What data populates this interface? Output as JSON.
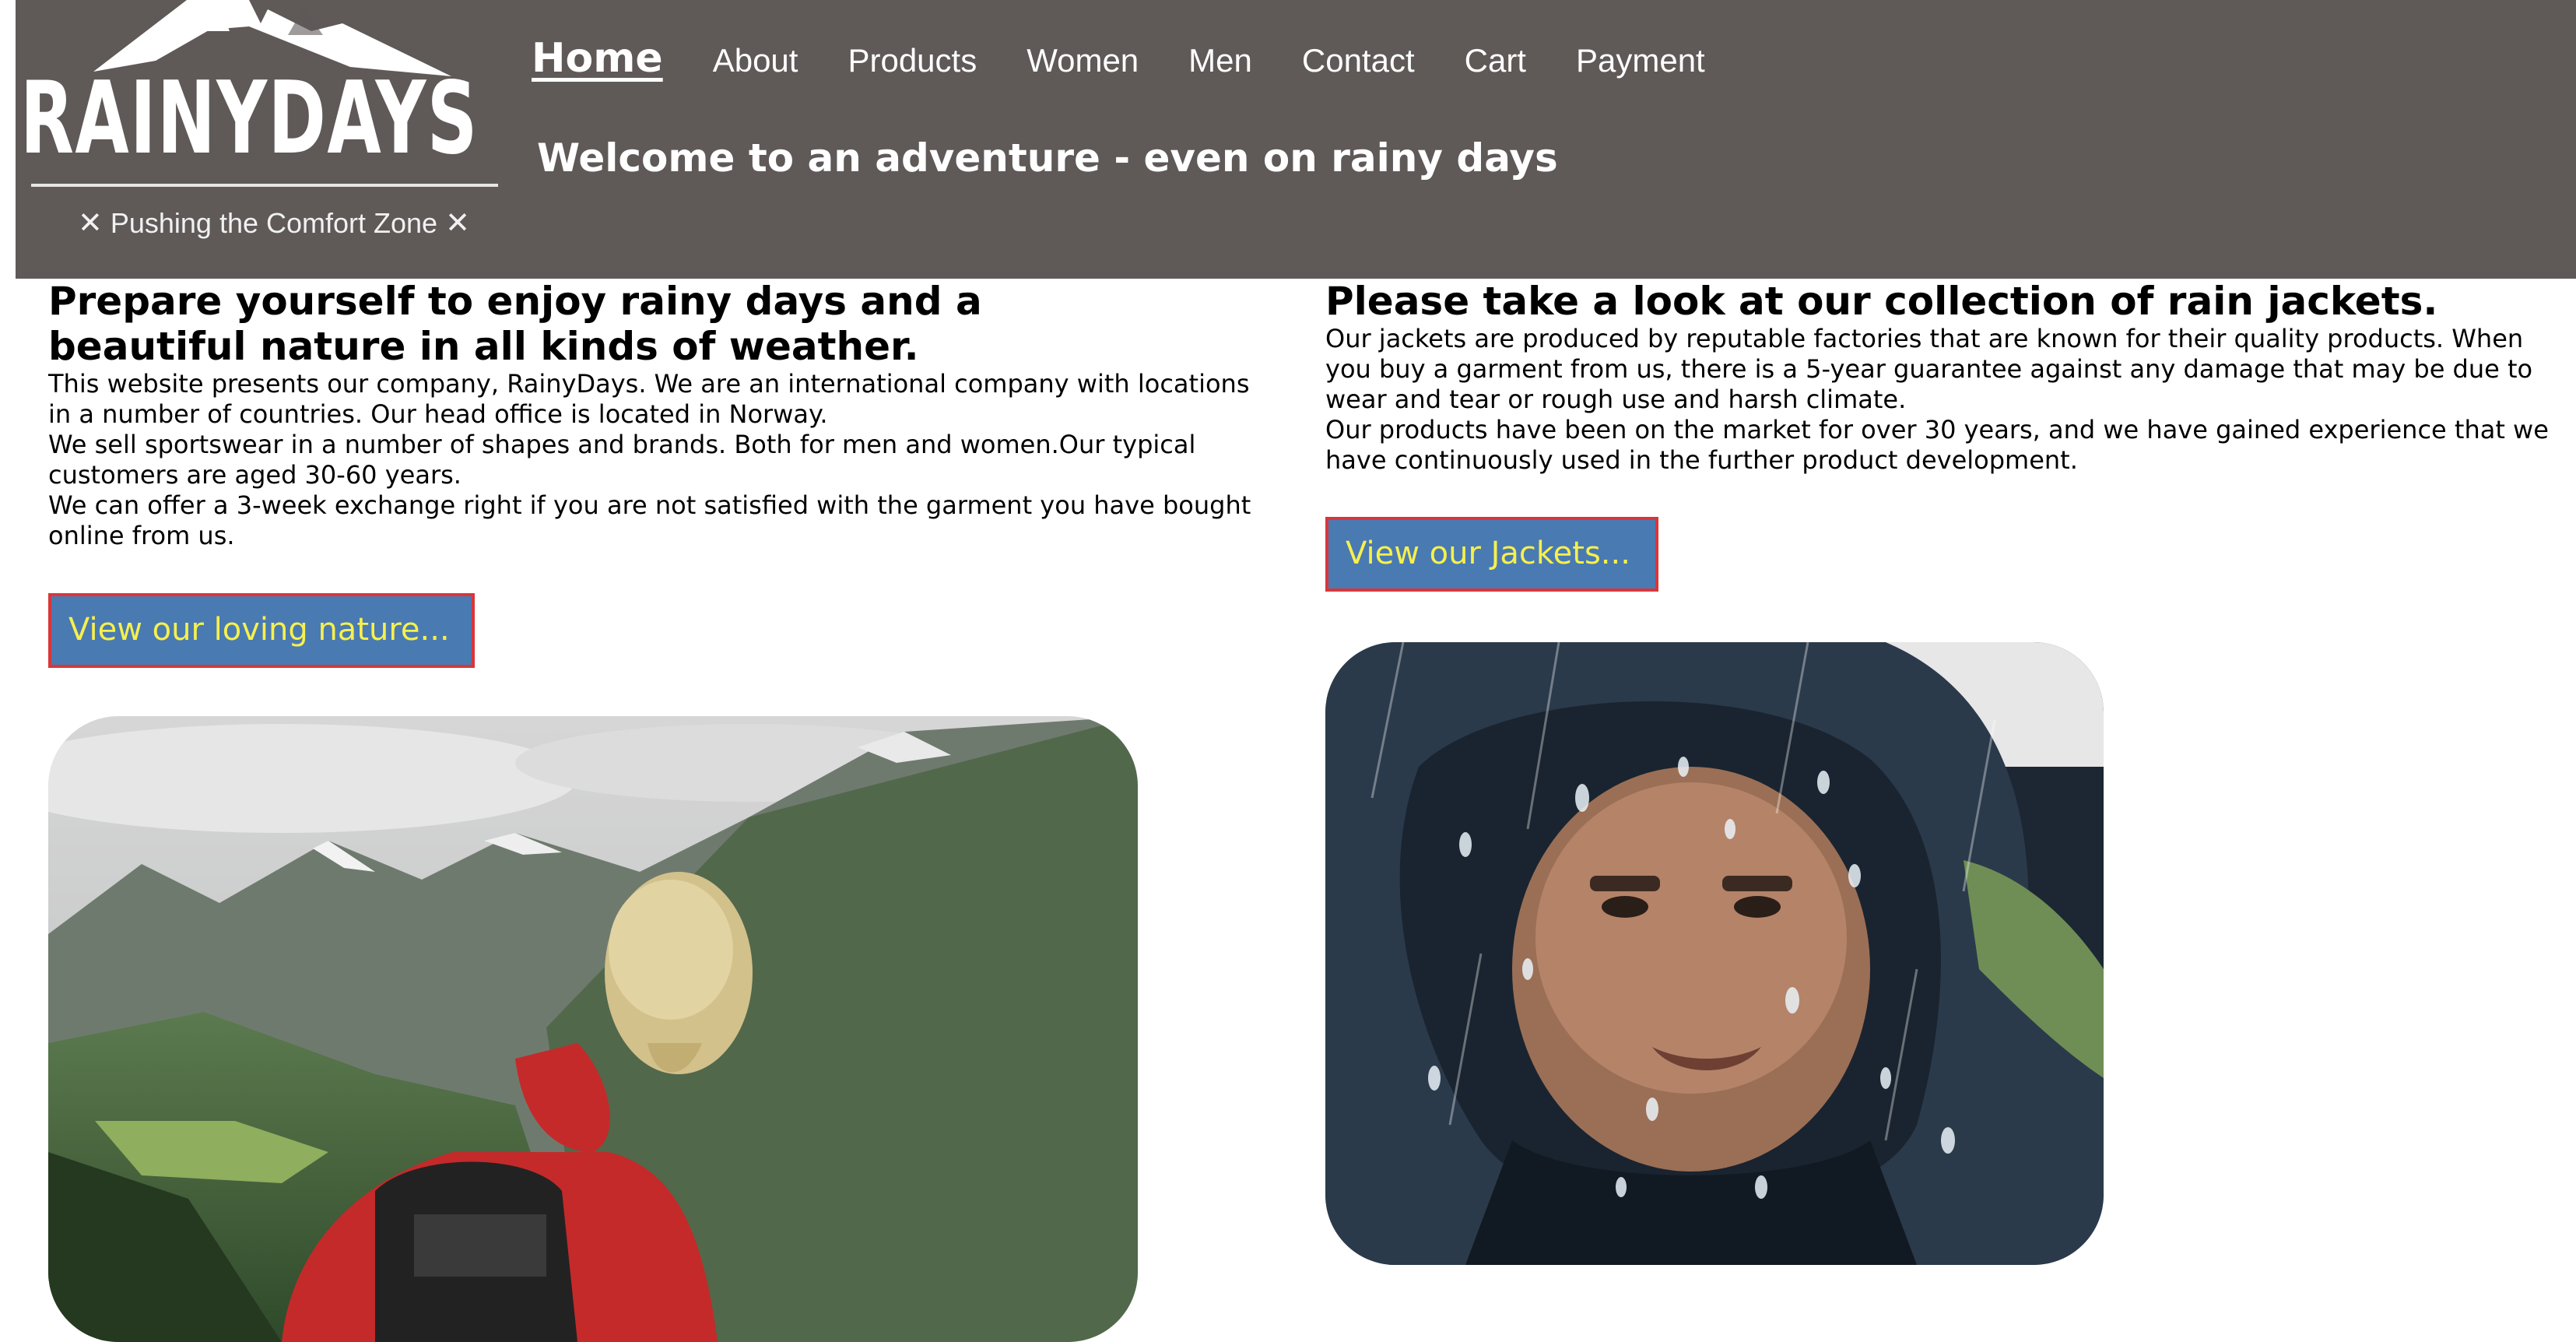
{
  "brand": {
    "name": "RAINYDAYS",
    "tagline": "Pushing the Comfort Zone",
    "icons": [
      "mountain-icon",
      "cross-icon"
    ]
  },
  "nav": {
    "items": [
      {
        "label": "Home",
        "active": true
      },
      {
        "label": "About"
      },
      {
        "label": "Products"
      },
      {
        "label": "Women"
      },
      {
        "label": "Men"
      },
      {
        "label": "Contact"
      },
      {
        "label": "Cart"
      },
      {
        "label": "Payment"
      }
    ]
  },
  "hero": {
    "tagline": "Welcome to an adventure - even on rainy days"
  },
  "left": {
    "heading": "Prepare yourself to enjoy rainy days and a beautiful nature in all kinds of weather.",
    "paragraphs": [
      "This website presents our company, RainyDays. We are an international company with locations in a number of countries. Our head office is located in Norway.",
      "We sell sportswear in a number of shapes and brands. Both for men and women.Our typical customers are aged 30-60 years.",
      "We can offer a 3-week exchange right if you are not satisfied with the garment you have bought online from us."
    ],
    "button": "View our loving nature...",
    "image": "hiker-in-mountains-photo"
  },
  "right": {
    "heading": "Please take a look at our collection of rain jackets.",
    "paragraphs": [
      "Our jackets are produced by reputable factories that are known for their quality products. When you buy a garment from us, there is a 5-year guarantee against any damage that may be due to wear and tear or rough use and harsh climate.",
      "Our products have been on the market for over 30 years, and we have gained experience that we have continuously used in the further product development."
    ],
    "button": "View our Jackets...",
    "image": "man-in-rain-jacket-photo"
  },
  "colors": {
    "header_bg": "#5f5958",
    "button_bg": "#4a7ab2",
    "button_text": "#f6f04d",
    "button_border": "#d9363a"
  }
}
